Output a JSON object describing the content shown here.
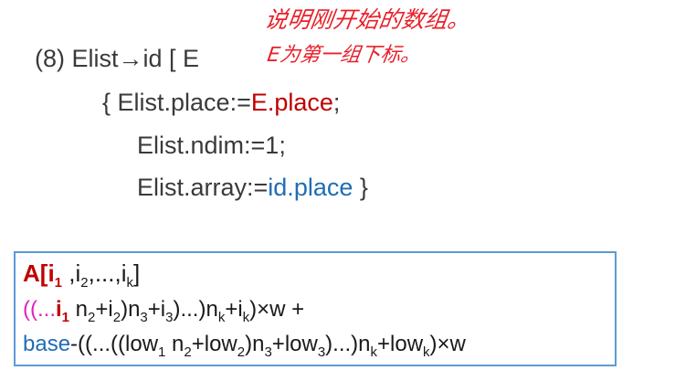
{
  "annotation": {
    "line1": "说明刚开始的数组。",
    "line2": "E为第一组下标。"
  },
  "rule": {
    "header_prefix": "(8)  Elist",
    "arrow": "→",
    "header_suffix": "id [ E",
    "s1_prefix": "{  Elist.place:=",
    "s1_value": "E.place",
    "s1_suffix": ";",
    "s2": "Elist.ndim:=1;",
    "s3_prefix": "Elist.array:=",
    "s3_value": "id.place",
    "s3_suffix": "  }"
  },
  "formula": {
    "l1_a": "A[",
    "l1_i1": "i",
    "l1_i1_sub": "1",
    "l1_rest": " ,i",
    "l1_i2_sub": "2",
    "l1_dots": ",...,i",
    "l1_ik_sub": "k",
    "l1_close": "]",
    "l2_open": "((...",
    "l2_i1": "i",
    "l2_i1_sub": "1",
    "l2_n2": " n",
    "l2_n2_sub": "2",
    "l2_plus_i2": "+i",
    "l2_i2_sub": "2",
    "l2_n3": ")n",
    "l2_n3_sub": "3",
    "l2_plus_i3": "+i",
    "l2_i3_sub": "3",
    "l2_nk": ")...)n",
    "l2_nk_sub": "k",
    "l2_plus_ik": "+i",
    "l2_ik_sub": "k",
    "l2_tail": ")×w +",
    "l3_base": "base",
    "l3_open": "-((...((low",
    "l3_low1_sub": "1",
    "l3_n2": " n",
    "l3_n2_sub": "2",
    "l3_low2": "+low",
    "l3_low2_sub": "2",
    "l3_n3": ")n",
    "l3_n3_sub": "3",
    "l3_low3": "+low",
    "l3_low3_sub": "3",
    "l3_nk": ")...)n",
    "l3_nk_sub": "k",
    "l3_lowk": "+low",
    "l3_lowk_sub": "k",
    "l3_tail": ")×w"
  }
}
